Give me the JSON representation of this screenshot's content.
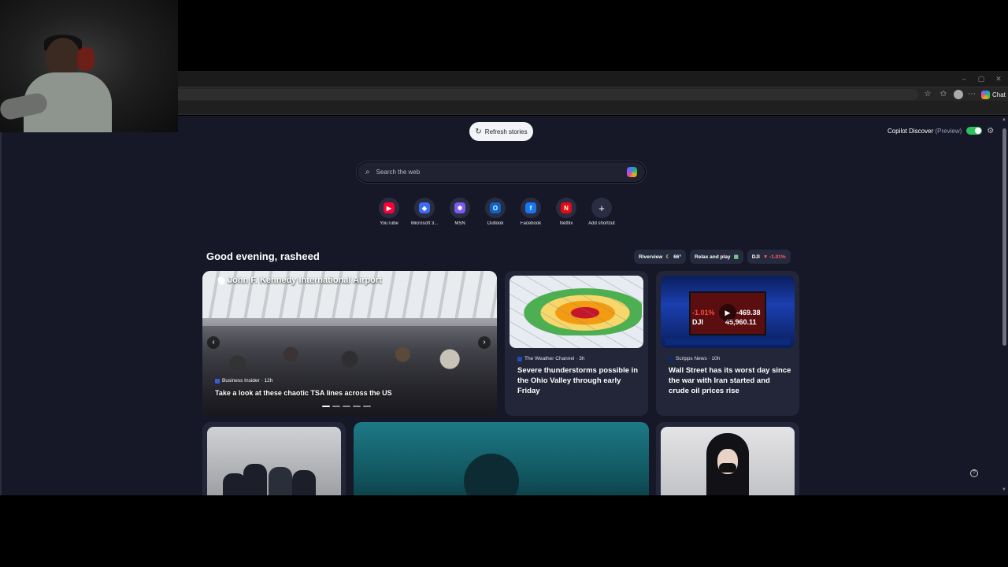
{
  "browser": {
    "window_controls": [
      "–",
      "▢",
      "✕"
    ],
    "toolbar": {
      "chat_label": "Chat"
    }
  },
  "page": {
    "refresh_label": "Refresh stories",
    "copilot_discover": {
      "label": "Copilot Discover",
      "preview": "(Preview)",
      "enabled": true
    },
    "search": {
      "placeholder": "Search the web"
    },
    "shortcuts": [
      {
        "label": "YouTube",
        "icon": "youtube-icon",
        "color": "#ff0033",
        "glyph": "▶"
      },
      {
        "label": "Microsoft 3...",
        "icon": "microsoft-365-icon",
        "color": "#3b6df0",
        "glyph": "◆"
      },
      {
        "label": "MSN",
        "icon": "msn-icon",
        "color": "#7b5cf0",
        "glyph": "✱"
      },
      {
        "label": "Outlook",
        "icon": "outlook-icon",
        "color": "#0a64c8",
        "glyph": "O"
      },
      {
        "label": "Facebook",
        "icon": "facebook-icon",
        "color": "#1877f2",
        "glyph": "f"
      },
      {
        "label": "Netflix",
        "icon": "netflix-icon",
        "color": "#e50914",
        "glyph": "N"
      },
      {
        "label": "Add shortcut",
        "icon": "plus-icon",
        "color": "#2a2d42",
        "glyph": "+"
      }
    ],
    "greeting": "Good evening, rasheed",
    "pills": {
      "weather": {
        "label": "Riverview",
        "icon": "moon-icon",
        "temp": "66°"
      },
      "game": {
        "label": "Relax and play",
        "icon": "game-icon"
      },
      "market": {
        "label": "DJI",
        "change": "▼ -1.01%",
        "color": "#ff5a6a"
      }
    },
    "hero": {
      "location": "John F. Kennedy International Airport",
      "source": "Business Insider · 12h",
      "headline": "Take a look at these chaotic TSA lines across the US"
    },
    "weather_card": {
      "source": "The Weather Channel · 3h",
      "headline": "Severe thunderstorms possible in the Ohio Valley through early Friday"
    },
    "market_card": {
      "source": "Scripps News · 10h",
      "headline": "Wall Street has its worst day since the war with Iran started and crude oil prices rise",
      "screen": {
        "pct": "-1.01%",
        "delta": "-469.38",
        "index": "DJI",
        "value": "45,960.11"
      }
    }
  }
}
